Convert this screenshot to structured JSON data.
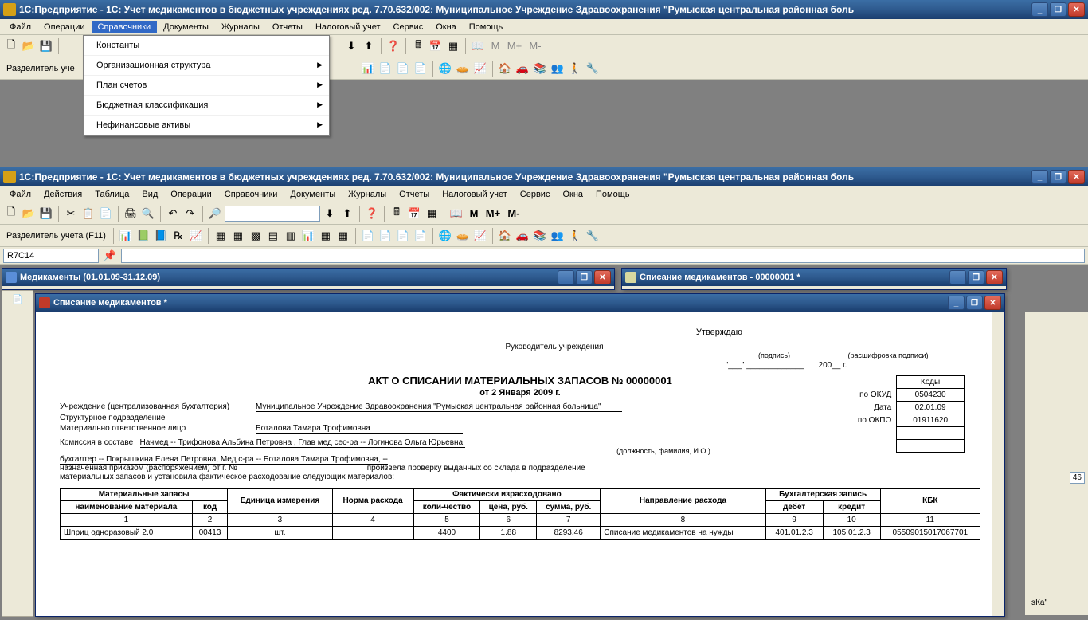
{
  "app_title": "1С:Предприятие - 1С: Учет медикаментов в бюджетных учреждениях ред. 7.70.632/002:  Муниципальное Учреждение Здравоохранения \"Румыская центральная районная боль",
  "menus": {
    "file": "Файл",
    "operations": "Операции",
    "spravochniki": "Справочники",
    "documents": "Документы",
    "journals": "Журналы",
    "reports": "Отчеты",
    "tax": "Налоговый учет",
    "service": "Сервис",
    "windows": "Окна",
    "help": "Помощь",
    "actions": "Действия",
    "table": "Таблица",
    "view": "Вид"
  },
  "dropdown": {
    "constants": "Константы",
    "orgstruct": "Организационная структура",
    "plan": "План счетов",
    "budget": "Бюджетная классификация",
    "nonfin": "Нефинансовые активы"
  },
  "toolbar2": {
    "razdel": "Разделитель уче",
    "razdel_full": "Разделитель учета (F11)",
    "m": "М",
    "mplus": "М+",
    "mminus": "М-"
  },
  "cellref": "R7C14",
  "child1_title": "Медикаменты (01.01.09-31.12.09)",
  "child2_title": "Списание медикаментов  - 00000001 *",
  "child3_title": "Списание медикаментов  *",
  "doc": {
    "approve": "Утверждаю",
    "head": "Руководитель учреждения",
    "sign": "(подпись)",
    "decode": "(расшифровка подписи)",
    "year_suffix": "200__ г.",
    "title": "АКТ О СПИСАНИИ МАТЕРИАЛЬНЫХ ЗАПАСОВ  № 00000001",
    "date": "от 2 Января 2009 г.",
    "codes_hdr": "Коды",
    "okud_lbl": "по ОКУД",
    "okud": "0504230",
    "date_lbl": "Дата",
    "date_val": "02.01.09",
    "okpo_lbl": "по ОКПО",
    "okpo": "01911620",
    "org_lbl": "Учреждение (централизованная бухгалтерия)",
    "org": "Муниципальное Учреждение Здравоохранения \"Румыская центральная районная больница\"",
    "struct_lbl": "Структурное подразделение",
    "resp_lbl": "Материально ответственное лицо",
    "resp": "Боталова Тамара Трофимовна",
    "comm_lbl": "Комиссия в составе",
    "comm1": "Начмед -- Трифонова Альбина Петровна , Глав мед сес-ра -- Логинова Ольга  Юрьевна,",
    "comm_note": "(должность, фамилия, И.О.)",
    "comm2": "бухгалтер -- Покрышкина Елена Петровна, Мед  с-ра -- Боталова Тамара Трофимовна,  --",
    "order1": "назначенная приказом (распоряжением)      от      г. №",
    "order2": "произвела проверку выданных со склада в подразделение",
    "order3": "материальных запасов и установила фактическое расходование следующих материалов:",
    "th_mat": "Материальные запасы",
    "th_name": "наименование материала",
    "th_code": "код",
    "th_unit": "Единица измерения",
    "th_norm": "Норма расхода",
    "th_fact": "Фактически израсходовано",
    "th_qty": "коли-чество",
    "th_price": "цена, руб.",
    "th_sum": "сумма, руб.",
    "th_dir": "Направление расхода",
    "th_book": "Бухгалтерская запись",
    "th_debet": "дебет",
    "th_credit": "кредит",
    "th_kbk": "КБК",
    "row": {
      "n1": "1",
      "n2": "2",
      "n3": "3",
      "n4": "4",
      "n5": "5",
      "n6": "6",
      "n7": "7",
      "n8": "8",
      "n9": "9",
      "n10": "10",
      "n11": "11",
      "name": "Шприц одноразовый 2.0",
      "code": "00413",
      "unit": "шт.",
      "qty": "4400",
      "price": "1.88",
      "sum": "8293.46",
      "dir": "Списание медикаментов на нужды",
      "debet": "401.01.2.3",
      "credit": "105.01.2.3",
      "kbk": "05509015017067701"
    }
  },
  "misc": {
    "eka": "эКа\"",
    "num46": "46"
  }
}
